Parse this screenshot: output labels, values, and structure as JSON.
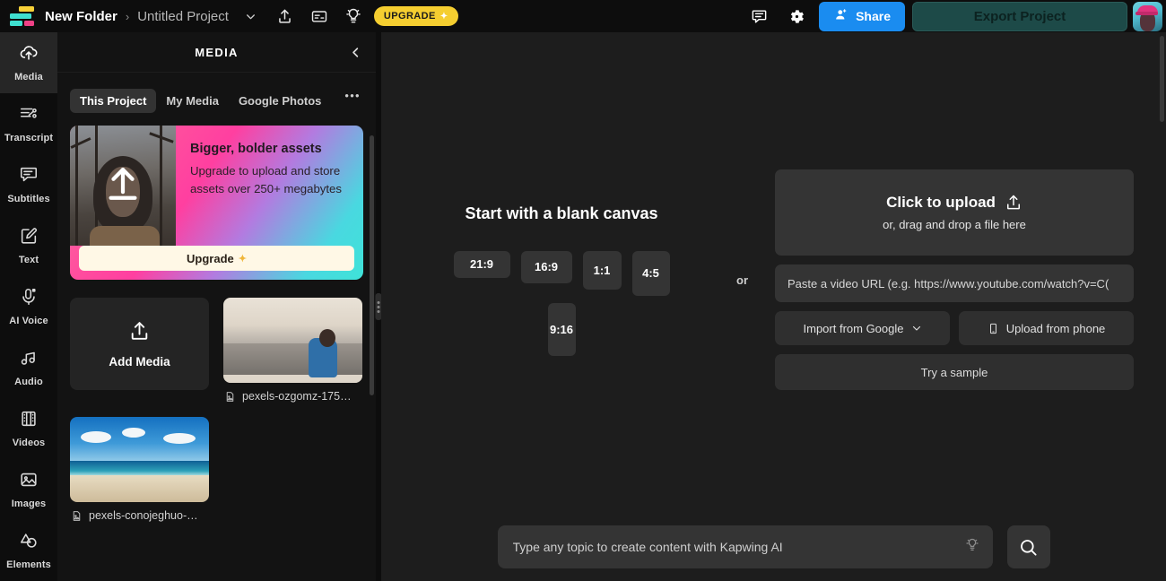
{
  "topbar": {
    "logo_name": "kapwing-logo",
    "breadcrumb_folder": "New Folder",
    "breadcrumb_separator": "›",
    "breadcrumb_project": "Untitled Project",
    "project_dropdown_icon": "chevron-down-icon",
    "share_icon": "share-upload-icon",
    "caption_icon": "captions-icon",
    "idea_icon": "lightbulb-icon",
    "upgrade_label": "UPGRADE",
    "upgrade_sparkle": "✦",
    "comment_icon": "comment-icon",
    "settings_icon": "gear-icon",
    "share_label": "Share",
    "export_label": "Export Project",
    "avatar_name": "user-avatar"
  },
  "rail": {
    "items": [
      {
        "label": "Media",
        "icon": "media-upload-icon",
        "active": true
      },
      {
        "label": "Transcript",
        "icon": "transcript-icon",
        "active": false
      },
      {
        "label": "Subtitles",
        "icon": "subtitles-icon",
        "active": false
      },
      {
        "label": "Text",
        "icon": "text-edit-icon",
        "active": false
      },
      {
        "label": "AI Voice",
        "icon": "microphone-ai-icon",
        "active": false
      },
      {
        "label": "Audio",
        "icon": "music-note-icon",
        "active": false
      },
      {
        "label": "Videos",
        "icon": "film-strip-icon",
        "active": false
      },
      {
        "label": "Images",
        "icon": "image-icon",
        "active": false
      },
      {
        "label": "Elements",
        "icon": "shapes-icon",
        "active": false
      }
    ]
  },
  "panel": {
    "title": "MEDIA",
    "collapse_icon": "chevron-left-icon",
    "more_icon": "more-options-icon",
    "more_glyph": "●●●",
    "tabs": [
      {
        "label": "This Project",
        "active": true
      },
      {
        "label": "My Media",
        "active": false
      },
      {
        "label": "Google Photos",
        "active": false
      }
    ],
    "promo": {
      "heading": "Bigger, bolder assets",
      "body": "Upgrade to upload and store assets over 250+ megabytes",
      "button_label": "Upgrade",
      "button_sparkle": "✦",
      "image_icon": "upload-arrow-icon"
    },
    "add_media": {
      "label": "Add Media",
      "icon": "upload-tray-icon"
    },
    "assets": [
      {
        "name": "pexels-ozgomz-175…",
        "icon": "image-file-icon"
      },
      {
        "name": "pexels-conojeghuo-…",
        "icon": "image-file-icon"
      }
    ]
  },
  "main": {
    "blank": {
      "heading": "Start with a blank canvas",
      "ratios_row1": [
        "21:9",
        "16:9",
        "1:1",
        "4:5"
      ],
      "ratios_row2": [
        "9:16"
      ],
      "or_label": "or"
    },
    "upload": {
      "dropzone_title": "Click to upload",
      "dropzone_icon": "upload-tray-icon",
      "dropzone_subtitle": "or, drag and drop a file here",
      "url_placeholder": "Paste a video URL (e.g. https://www.youtube.com/watch?v=C(",
      "url_value": "",
      "import_google_label": "Import from Google",
      "import_google_icon": "chevron-down-icon",
      "upload_phone_label": "Upload from phone",
      "upload_phone_icon": "phone-icon",
      "try_sample_label": "Try a sample"
    },
    "ai": {
      "placeholder": "Type any topic to create content with Kapwing AI",
      "value": "",
      "bulb_icon": "lightbulb-icon",
      "search_icon": "search-icon"
    }
  },
  "colors": {
    "accent_blue": "#1a8cf0",
    "upgrade_yellow": "#f5ce30",
    "export_teal": "#1d4a48",
    "panel_bg": "#131313",
    "canvas_bg": "#1d1d1d",
    "logo_yellow": "#f7d038",
    "logo_teal": "#3fe0d0",
    "logo_pink": "#ef4186"
  }
}
